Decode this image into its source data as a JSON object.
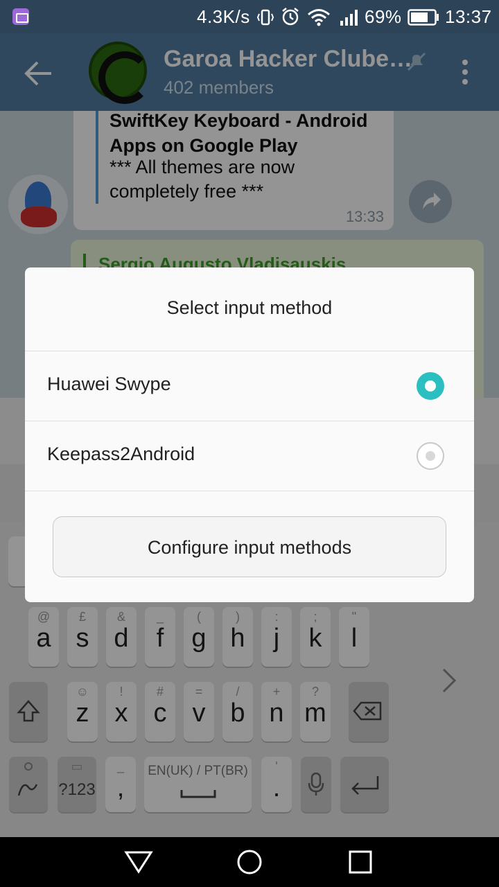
{
  "status_bar": {
    "speed": "4.3K/s",
    "battery": "69%",
    "time": "13:37"
  },
  "app_bar": {
    "title": "Garoa Hacker Clube…",
    "subtitle": "402 members"
  },
  "chat": {
    "message1": {
      "link_title": "SwiftKey Keyboard - Android Apps on Google Play",
      "text": "*** All themes are now completely free ***",
      "time": "13:33"
    },
    "message2": {
      "author": "Sergio Augusto Vladisauskis"
    }
  },
  "keyboard": {
    "row2": [
      {
        "main": "a",
        "sec": "@"
      },
      {
        "main": "s",
        "sec": "£"
      },
      {
        "main": "d",
        "sec": "&"
      },
      {
        "main": "f",
        "sec": "_"
      },
      {
        "main": "g",
        "sec": "("
      },
      {
        "main": "h",
        "sec": ")"
      },
      {
        "main": "j",
        "sec": ":"
      },
      {
        "main": "k",
        "sec": ";"
      },
      {
        "main": "l",
        "sec": "\""
      }
    ],
    "row3": [
      {
        "main": "z",
        "sec": "☺"
      },
      {
        "main": "x",
        "sec": "!"
      },
      {
        "main": "c",
        "sec": "#"
      },
      {
        "main": "v",
        "sec": "="
      },
      {
        "main": "b",
        "sec": "/"
      },
      {
        "main": "n",
        "sec": "+"
      },
      {
        "main": "m",
        "sec": "?"
      }
    ],
    "symbols_key": "?123",
    "comma_key": ",",
    "comma_sec": "_",
    "space_label": "EN(UK) / PT(BR)",
    "period_key": ".",
    "period_sec": "'"
  },
  "dialog": {
    "title": "Select input method",
    "options": [
      {
        "label": "Huawei Swype",
        "selected": true
      },
      {
        "label": "Keepass2Android",
        "selected": false
      }
    ],
    "configure_button": "Configure input methods"
  },
  "colors": {
    "status_bar": "#2c4358",
    "app_bar": "#527da3",
    "radio_accent": "#2cbfc2"
  }
}
